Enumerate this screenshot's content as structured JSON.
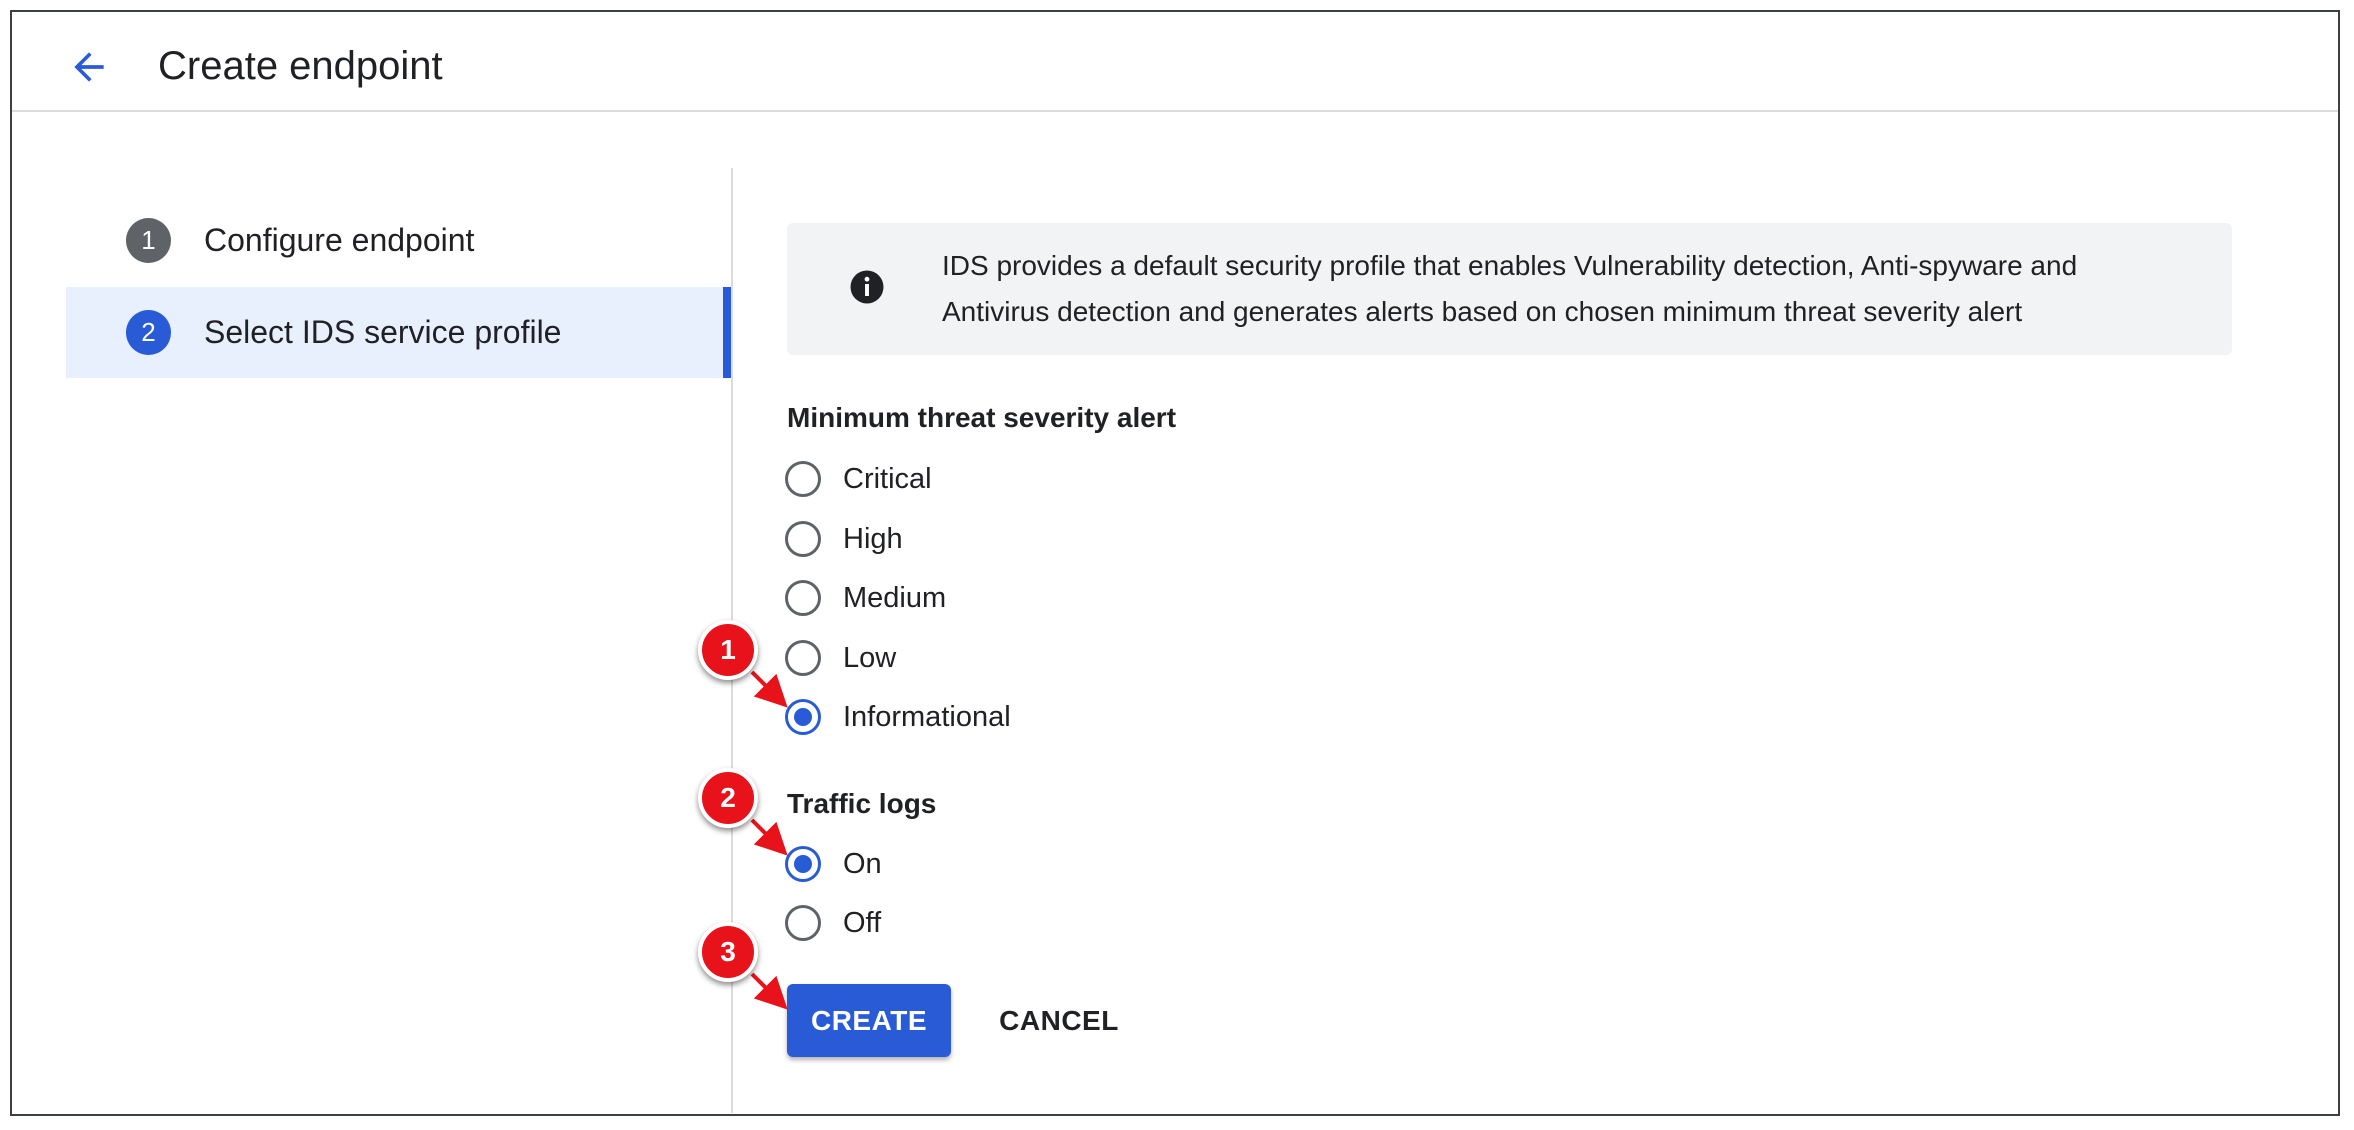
{
  "header": {
    "title": "Create endpoint",
    "back_icon": "arrow-back-icon"
  },
  "steps": [
    {
      "number": "1",
      "label": "Configure endpoint",
      "state": "completed"
    },
    {
      "number": "2",
      "label": "Select IDS service profile",
      "state": "active"
    }
  ],
  "info": {
    "icon": "info-icon",
    "text": "IDS provides a default security profile that enables Vulnerability detection, Anti-spyware and Antivirus detection and generates alerts based on chosen minimum threat severity alert"
  },
  "severity": {
    "title": "Minimum threat severity alert",
    "options": [
      "Critical",
      "High",
      "Medium",
      "Low",
      "Informational"
    ],
    "selected": "Informational"
  },
  "traffic_logs": {
    "title": "Traffic logs",
    "options": [
      "On",
      "Off"
    ],
    "selected": "On"
  },
  "actions": {
    "create_label": "CREATE",
    "cancel_label": "CANCEL"
  },
  "callouts": [
    "1",
    "2",
    "3"
  ],
  "colors": {
    "accent": "#2a5bd7",
    "callout": "#e8121a",
    "step_active_bg": "#e8f0fe"
  }
}
